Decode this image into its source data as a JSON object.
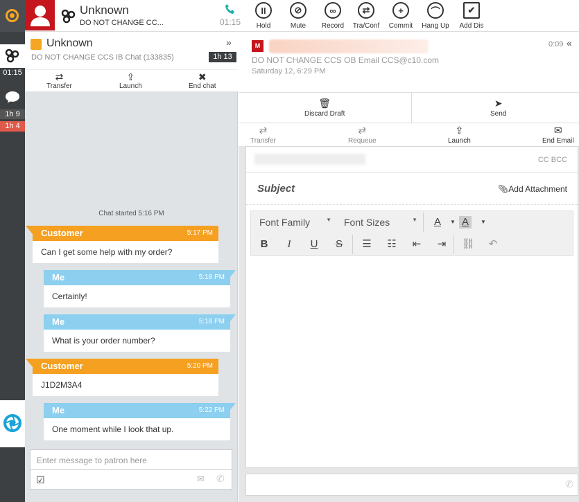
{
  "rail": {
    "call_time": "01:15",
    "chat_time1": "1h 9",
    "chat_time2": "1h 4"
  },
  "topbar": {
    "contact_name": "Unknown",
    "contact_sub": "DO NOT CHANGE CC...",
    "call_timer": "01:15",
    "buttons": [
      {
        "label": "Hold",
        "icon": "pause-icon",
        "glyph": "II"
      },
      {
        "label": "Mute",
        "icon": "mic-mute-icon",
        "glyph": "⊘"
      },
      {
        "label": "Record",
        "icon": "voicemail-icon",
        "glyph": "∞"
      },
      {
        "label": "Tra/Conf",
        "icon": "transfer-icon",
        "glyph": "⇄"
      },
      {
        "label": "Commit",
        "icon": "plus-icon",
        "glyph": "+"
      },
      {
        "label": "Hang Up",
        "icon": "hangup-icon",
        "glyph": "⌒"
      },
      {
        "label": "Add Dis",
        "icon": "checkbox-icon",
        "glyph": "✔"
      }
    ]
  },
  "chat": {
    "name": "Unknown",
    "subtitle": "DO NOT CHANGE CCS IB Chat (133835)",
    "duration": "1h 13",
    "actions": {
      "transfer": "Transfer",
      "launch": "Launch",
      "end": "End chat"
    },
    "started": "Chat started 5:16 PM",
    "messages": [
      {
        "sender": "Customer",
        "time": "5:17 PM",
        "text": "Can I get some help with my order?"
      },
      {
        "sender": "Me",
        "time": "5:18 PM",
        "text": "Certainly!"
      },
      {
        "sender": "Me",
        "time": "5:18 PM",
        "text": "What is your order number?"
      },
      {
        "sender": "Customer",
        "time": "5:20 PM",
        "text": "J1D2M3A4"
      },
      {
        "sender": "Me",
        "time": "5:22 PM",
        "text": "One moment while I look that up."
      }
    ],
    "input_placeholder": "Enter message to patron here"
  },
  "email": {
    "badge": "M",
    "subject_line": "DO NOT CHANGE CCS OB Email  CCS@c10.com",
    "date": "Saturday 12, 6:29 PM",
    "timer": "0:09",
    "discard": "Discard Draft",
    "send": "Send",
    "actions": {
      "transfer": "Transfer",
      "requeue": "Requeue",
      "launch": "Launch",
      "end": "End Email"
    },
    "cc_bcc": "CC BCC",
    "subject_placeholder": "Subject",
    "add_attachment": "Add Attachment",
    "font_family": "Font Family",
    "font_sizes": "Font Sizes"
  },
  "colors": {
    "accent_orange": "#f5a020",
    "me_blue": "#8ccfef",
    "brand_red": "#c4161c",
    "rail_dark": "#3c4043"
  }
}
